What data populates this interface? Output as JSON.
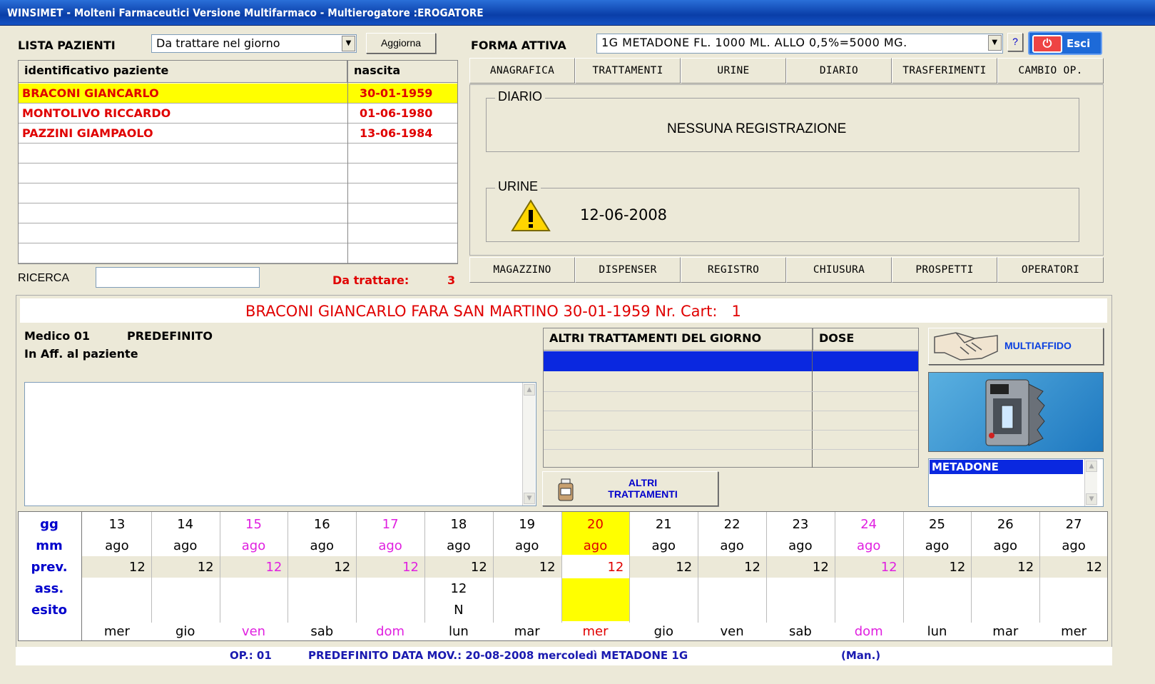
{
  "window": {
    "title": "WINSIMET - Molteni Farmaceutici Versione Multifarmaco - Multierogatore :EROGATORE"
  },
  "patients": {
    "label": "LISTA PAZIENTI",
    "filter_value": "Da trattare nel giorno",
    "refresh_label": "Aggiorna",
    "col_id": "identificativo paziente",
    "col_birth": "nascita",
    "rows": [
      {
        "name": "BRACONI GIANCARLO",
        "birth": "30-01-1959"
      },
      {
        "name": "MONTOLIVO RICCARDO",
        "birth": "01-06-1980"
      },
      {
        "name": "PAZZINI GIAMPAOLO",
        "birth": "13-06-1984"
      }
    ],
    "search_label": "RICERCA",
    "search_value": "",
    "to_treat_label": "Da trattare:",
    "to_treat_count": "3"
  },
  "form": {
    "label": "FORMA ATTIVA",
    "value": "1G  METADONE FL. 1000 ML. ALLO 0,5%=5000 MG.",
    "help_label": "?",
    "exit_label": "Esci"
  },
  "top_tabs": [
    "ANAGRAFICA",
    "TRATTAMENTI",
    "URINE",
    "DIARIO",
    "TRASFERIMENTI",
    "CAMBIO OP."
  ],
  "diario": {
    "legend": "DIARIO",
    "text": "NESSUNA REGISTRAZIONE"
  },
  "urine": {
    "legend": "URINE",
    "date": "12-06-2008",
    "icon": "warning-icon"
  },
  "bottom_tabs": [
    "MAGAZZINO",
    "DISPENSER",
    "REGISTRO",
    "CHIUSURA",
    "PROSPETTI",
    "OPERATORI"
  ],
  "patient_header": {
    "name": "BRACONI GIANCARLO",
    "city": "FARA SAN MARTINO",
    "birth": "30-01-1959",
    "cart_label": "Nr. Cart:",
    "cart_number": "1"
  },
  "doctor": {
    "label": "Medico 01",
    "value": "PREDEFINITO",
    "assignment": "In Aff. al paziente"
  },
  "other_treatments": {
    "col_name": "ALTRI TRATTAMENTI DEL GIORNO",
    "col_dose": "DOSE",
    "button_line1": "ALTRI",
    "button_line2": "TRATTAMENTI"
  },
  "multiaffido_label": "MULTIAFFIDO",
  "drug_list": {
    "items": [
      "METADONE"
    ]
  },
  "calendar": {
    "row_labels": [
      "gg",
      "mm",
      "prev.",
      "ass.",
      "esito"
    ],
    "days": [
      {
        "gg": "13",
        "mm": "ago",
        "prev": "12",
        "ass": "",
        "esito": "",
        "dow": "mer",
        "type": "normal"
      },
      {
        "gg": "14",
        "mm": "ago",
        "prev": "12",
        "ass": "",
        "esito": "",
        "dow": "gio",
        "type": "normal"
      },
      {
        "gg": "15",
        "mm": "ago",
        "prev": "12",
        "ass": "",
        "esito": "",
        "dow": "ven",
        "type": "holiday"
      },
      {
        "gg": "16",
        "mm": "ago",
        "prev": "12",
        "ass": "",
        "esito": "",
        "dow": "sab",
        "type": "normal"
      },
      {
        "gg": "17",
        "mm": "ago",
        "prev": "12",
        "ass": "",
        "esito": "",
        "dow": "dom",
        "type": "holiday"
      },
      {
        "gg": "18",
        "mm": "ago",
        "prev": "12",
        "ass": "12",
        "esito": "N",
        "dow": "lun",
        "type": "normal"
      },
      {
        "gg": "19",
        "mm": "ago",
        "prev": "12",
        "ass": "",
        "esito": "",
        "dow": "mar",
        "type": "normal"
      },
      {
        "gg": "20",
        "mm": "ago",
        "prev": "12",
        "ass": "",
        "esito": "",
        "dow": "mer",
        "type": "today"
      },
      {
        "gg": "21",
        "mm": "ago",
        "prev": "12",
        "ass": "",
        "esito": "",
        "dow": "gio",
        "type": "normal"
      },
      {
        "gg": "22",
        "mm": "ago",
        "prev": "12",
        "ass": "",
        "esito": "",
        "dow": "ven",
        "type": "normal"
      },
      {
        "gg": "23",
        "mm": "ago",
        "prev": "12",
        "ass": "",
        "esito": "",
        "dow": "sab",
        "type": "normal"
      },
      {
        "gg": "24",
        "mm": "ago",
        "prev": "12",
        "ass": "",
        "esito": "",
        "dow": "dom",
        "type": "holiday"
      },
      {
        "gg": "25",
        "mm": "ago",
        "prev": "12",
        "ass": "",
        "esito": "",
        "dow": "lun",
        "type": "normal"
      },
      {
        "gg": "26",
        "mm": "ago",
        "prev": "12",
        "ass": "",
        "esito": "",
        "dow": "mar",
        "type": "normal"
      },
      {
        "gg": "27",
        "mm": "ago",
        "prev": "12",
        "ass": "",
        "esito": "",
        "dow": "mer",
        "type": "normal"
      }
    ]
  },
  "status": {
    "op_label": "OP.: 01",
    "text": "PREDEFINITO DATA MOV.: 20-08-2008 mercoledì METADONE 1G",
    "mode": "(Man.)"
  },
  "colors": {
    "title_bar": "#0a3ea8",
    "selected_row": "#ffff00",
    "patient_text": "#e00000",
    "holiday_text": "#e020e0",
    "label_blue": "#0000cc",
    "status_text": "#1a1ab0"
  }
}
